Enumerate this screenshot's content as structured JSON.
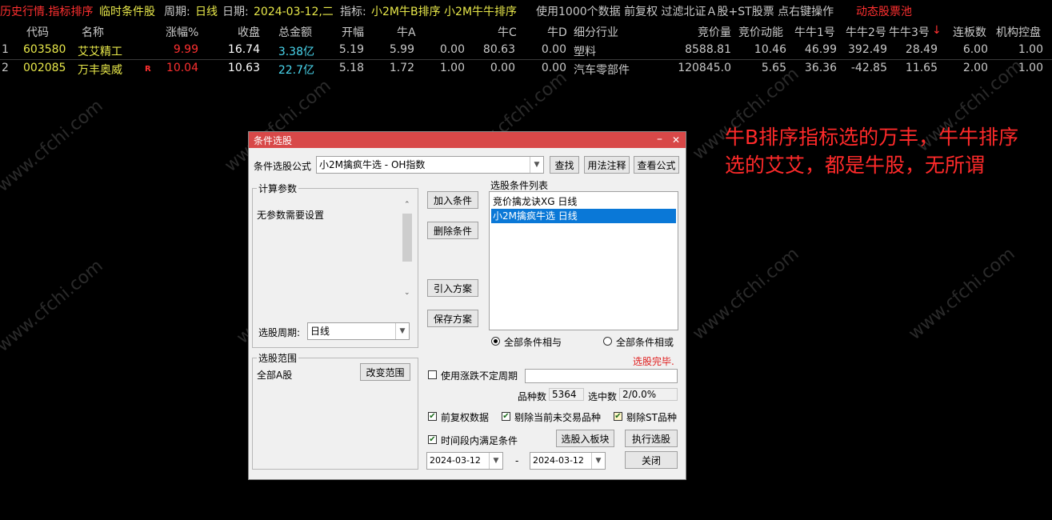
{
  "topbar": {
    "mode": "历史行情.指标排序",
    "condition_label": "临时条件股",
    "period_label": "周期:",
    "period_value": "日线",
    "date_label": "日期:",
    "date_value": "2024-03-12,二",
    "indicator_label": "指标:",
    "indicator_value": "小2M牛B排序 小2M牛牛排序",
    "info": "使用1000个数据 前复权 过滤北证Ａ股+ST股票 点右键操作",
    "pool": "动态股票池"
  },
  "table": {
    "headers": [
      "代码",
      "名称",
      "涨幅%",
      "收盘",
      "总金额",
      "开幅",
      "牛A",
      "牛C",
      "牛D",
      "细分行业",
      "竞价量",
      "竞价动能",
      "牛牛1号",
      "牛牛2号",
      "牛牛3号",
      "连板数",
      "机构控盘"
    ],
    "sort_indicator": "↓",
    "rows": [
      {
        "idx": "1",
        "code": "603580",
        "name": "艾艾精工",
        "flag": "",
        "change": "9.99",
        "close": "16.74",
        "amount": "3.38亿",
        "open": "5.19",
        "niuA": "5.99",
        "blank": "0.00",
        "niuC": "80.63",
        "niuD": "0.00",
        "industry": "塑料",
        "auction_vol": "8588.81",
        "auction_mom": "10.46",
        "n1": "46.99",
        "n2": "392.49",
        "n3": "28.49",
        "limit_days": "6.00",
        "inst": "1.00"
      },
      {
        "idx": "2",
        "code": "002085",
        "name": "万丰奥威",
        "flag": "R",
        "change": "10.04",
        "close": "10.63",
        "amount": "22.7亿",
        "open": "5.18",
        "niuA": "1.72",
        "blank": "1.00",
        "niuC": "0.00",
        "niuD": "0.00",
        "industry": "汽车零部件",
        "auction_vol": "120845.0",
        "auction_mom": "5.65",
        "n1": "36.36",
        "n2": "-42.85",
        "n3": "11.65",
        "limit_days": "2.00",
        "inst": "1.00"
      }
    ]
  },
  "watermark": "www.cfchi.com",
  "dialog": {
    "title": "条件选股",
    "minimize": "–",
    "close": "✕",
    "formula_label": "条件选股公式",
    "formula_value": "小2M擒疯牛选  -  OH指数",
    "find_btn": "查找",
    "usage_btn": "用法注释",
    "view_btn": "查看公式",
    "params_group": "计算参数",
    "params_text": "无参数需要设置",
    "add_btn": "加入条件",
    "del_btn": "删除条件",
    "import_btn": "引入方案",
    "save_btn": "保存方案",
    "list_label": "选股条件列表",
    "conditions": [
      "竞价擒龙诀XG  日线",
      "小2M擒疯牛选  日线"
    ],
    "period_label": "选股周期:",
    "period_value": "日线",
    "radio_and": "全部条件相与",
    "radio_or": "全部条件相或",
    "status": "选股完毕.",
    "scope_group": "选股范围",
    "scope_value": "全部A股",
    "change_scope_btn": "改变范围",
    "uncertain_label": "使用涨跌不定周期",
    "count_label": "品种数",
    "count_value": "5364",
    "selected_label": "选中数",
    "selected_value": "2/0.0%",
    "cb_adjust": "前复权数据",
    "cb_exclude_untraded": "剔除当前未交易品种",
    "cb_exclude_st": "剔除ST品种",
    "cb_time": "时间段内满足条件",
    "to_block_btn": "选股入板块",
    "run_btn": "执行选股",
    "date_from": "2024-03-12",
    "date_sep": "-",
    "date_to": "2024-03-12",
    "close_btn": "关闭"
  },
  "annotation": {
    "line1": "牛B排序指标选的万丰，牛牛排序",
    "line2": "选的艾艾，都是牛股，无所谓"
  },
  "colors": {
    "title_bar": "#d84848",
    "red": "#ff3030",
    "yellow": "#e8e84a",
    "cyan": "#4ad8f0",
    "selection": "#0a78d7"
  }
}
